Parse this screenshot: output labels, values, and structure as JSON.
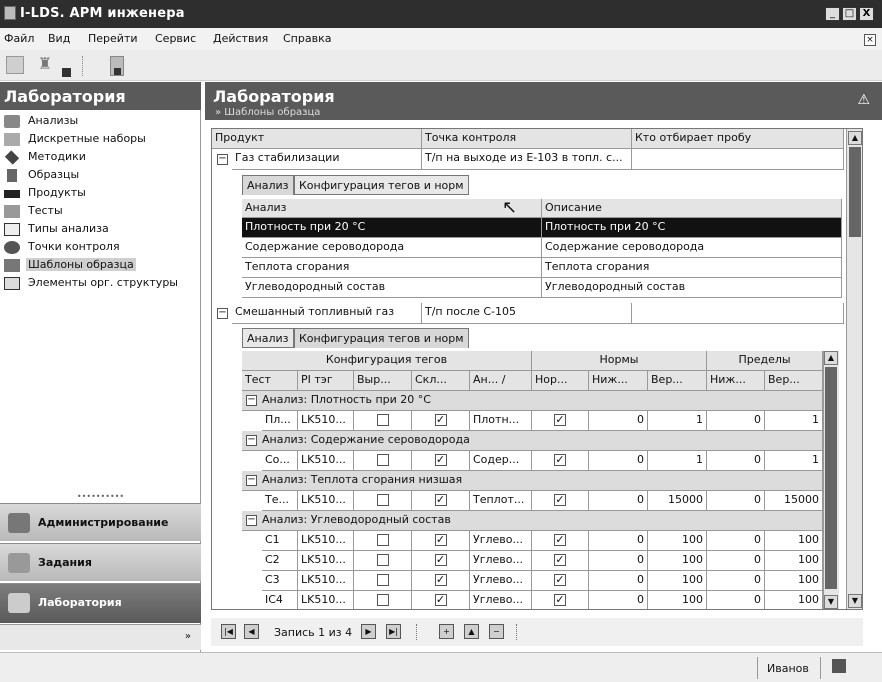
{
  "window": {
    "title": "I-LDS. АРМ инженера",
    "controls": [
      "_",
      "□",
      "X"
    ]
  },
  "menu": [
    "Файл",
    "Вид",
    "Перейти",
    "Сервис",
    "Действия",
    "Справка"
  ],
  "left": {
    "title": "Лаборатория",
    "items": [
      {
        "label": "Анализы",
        "icon": "analysis-icon"
      },
      {
        "label": "Дискретные наборы",
        "icon": "discrete-sets-icon"
      },
      {
        "label": "Методики",
        "icon": "methods-icon"
      },
      {
        "label": "Образцы",
        "icon": "samples-icon"
      },
      {
        "label": "Продукты",
        "icon": "products-icon"
      },
      {
        "label": "Тесты",
        "icon": "tests-icon"
      },
      {
        "label": "Типы анализа",
        "icon": "analysis-types-icon"
      },
      {
        "label": "Точки контроля",
        "icon": "control-points-icon"
      },
      {
        "label": "Шаблоны образца",
        "icon": "sample-templates-icon"
      },
      {
        "label": "Элементы орг. структуры",
        "icon": "org-structure-icon"
      }
    ],
    "selected_index": 8,
    "bottom_buttons": [
      {
        "label": "Администрирование",
        "icon": "admin-icon"
      },
      {
        "label": "Задания",
        "icon": "tasks-icon"
      },
      {
        "label": "Лаборатория",
        "icon": "laboratory-icon"
      }
    ]
  },
  "right": {
    "title": "Лаборатория",
    "breadcrumb": "» Шаблоны образца"
  },
  "grid": {
    "columns": [
      "Продукт",
      "Точка контроля",
      "Кто отбирает пробу"
    ],
    "product1": {
      "name": "Газ стабилизации",
      "point": "Т/п на выходе из Е-103 в топл. с..."
    },
    "tabs1": [
      "Анализ",
      "Конфигурация тегов и норм"
    ],
    "sub_columns": [
      "Анализ",
      "Описание"
    ],
    "analyses": [
      [
        "Плотность при 20 °С",
        "Плотность при 20 °С"
      ],
      [
        "Содержание сероводорода",
        "Содержание сероводорода"
      ],
      [
        "Теплота сгорания",
        "Теплота сгорания"
      ],
      [
        "Углеводородный состав",
        "Углеводородный состав"
      ]
    ],
    "product2": {
      "name": "Смешанный топливный газ",
      "point": "Т/п после С-105"
    },
    "tabs2": [
      "Анализ",
      "Конфигурация тегов и норм"
    ],
    "band_headers": [
      "Конфигурация тегов",
      "Нормы",
      "Пределы"
    ],
    "cfg_columns": [
      "Тест",
      "PI тэг",
      "Выр...",
      "Скл...",
      "Ан... /",
      "Нор...",
      "Ниж...",
      "Вер...",
      "Ниж...",
      "Вер..."
    ],
    "groups": [
      {
        "title": "Анализ: Плотность при 20 °С",
        "rows": [
          {
            "test": "Пл...",
            "tag": "LK510...",
            "vyr": false,
            "skl": true,
            "an": "Плотн...",
            "nor": true,
            "n_low": "0",
            "n_high": "1",
            "p_low": "0",
            "p_high": "1"
          }
        ]
      },
      {
        "title": "Анализ: Содержание сероводорода",
        "rows": [
          {
            "test": "Со...",
            "tag": "LK510...",
            "vyr": false,
            "skl": true,
            "an": "Содер...",
            "nor": true,
            "n_low": "0",
            "n_high": "1",
            "p_low": "0",
            "p_high": "1"
          }
        ]
      },
      {
        "title": "Анализ: Теплота сгорания низшая",
        "rows": [
          {
            "test": "Те...",
            "tag": "LK510...",
            "vyr": false,
            "skl": true,
            "an": "Теплот...",
            "nor": true,
            "n_low": "0",
            "n_high": "15000",
            "p_low": "0",
            "p_high": "15000"
          }
        ]
      },
      {
        "title": "Анализ: Углеводородный состав",
        "rows": [
          {
            "test": "C1",
            "tag": "LK510...",
            "vyr": false,
            "skl": true,
            "an": "Углево...",
            "nor": true,
            "n_low": "0",
            "n_high": "100",
            "p_low": "0",
            "p_high": "100"
          },
          {
            "test": "C2",
            "tag": "LK510...",
            "vyr": false,
            "skl": true,
            "an": "Углево...",
            "nor": true,
            "n_low": "0",
            "n_high": "100",
            "p_low": "0",
            "p_high": "100"
          },
          {
            "test": "C3",
            "tag": "LK510...",
            "vyr": false,
            "skl": true,
            "an": "Углево...",
            "nor": true,
            "n_low": "0",
            "n_high": "100",
            "p_low": "0",
            "p_high": "100"
          },
          {
            "test": "IC4",
            "tag": "LK510...",
            "vyr": false,
            "skl": true,
            "an": "Углево...",
            "nor": true,
            "n_low": "0",
            "n_high": "100",
            "p_low": "0",
            "p_high": "100"
          }
        ]
      }
    ]
  },
  "pager": {
    "label": "Запись 1 из 4"
  },
  "status": {
    "user": "Иванов"
  }
}
